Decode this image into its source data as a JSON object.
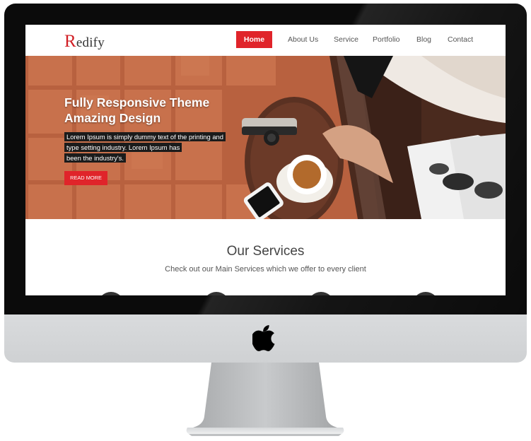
{
  "site": {
    "logo_initial": "R",
    "logo_rest": "edify"
  },
  "nav": {
    "items": [
      {
        "label": "Home",
        "active": true
      },
      {
        "label": "About Us",
        "active": false
      },
      {
        "label": "Service",
        "active": false
      },
      {
        "label": "Portfolio",
        "active": false
      },
      {
        "label": "Blog",
        "active": false
      },
      {
        "label": "Contact",
        "active": false
      }
    ]
  },
  "hero": {
    "title_line1": "Fully Responsive Theme",
    "title_line2": "Amazing Design",
    "text_line1": "Lorem Ipsum is simply dummy text of the printing and",
    "text_line2": "type setting industry. Lorem Ipsum has",
    "text_line3": "been the industry's.",
    "button_label": "READ MORE"
  },
  "services": {
    "title": "Our Services",
    "subtitle": "Check out our Main Services which we offer to every client"
  },
  "colors": {
    "accent": "#e0242a",
    "bezel": "#0b0b0b",
    "chin": "#d6d8da"
  },
  "icons": {
    "device_logo": "apple-icon"
  }
}
